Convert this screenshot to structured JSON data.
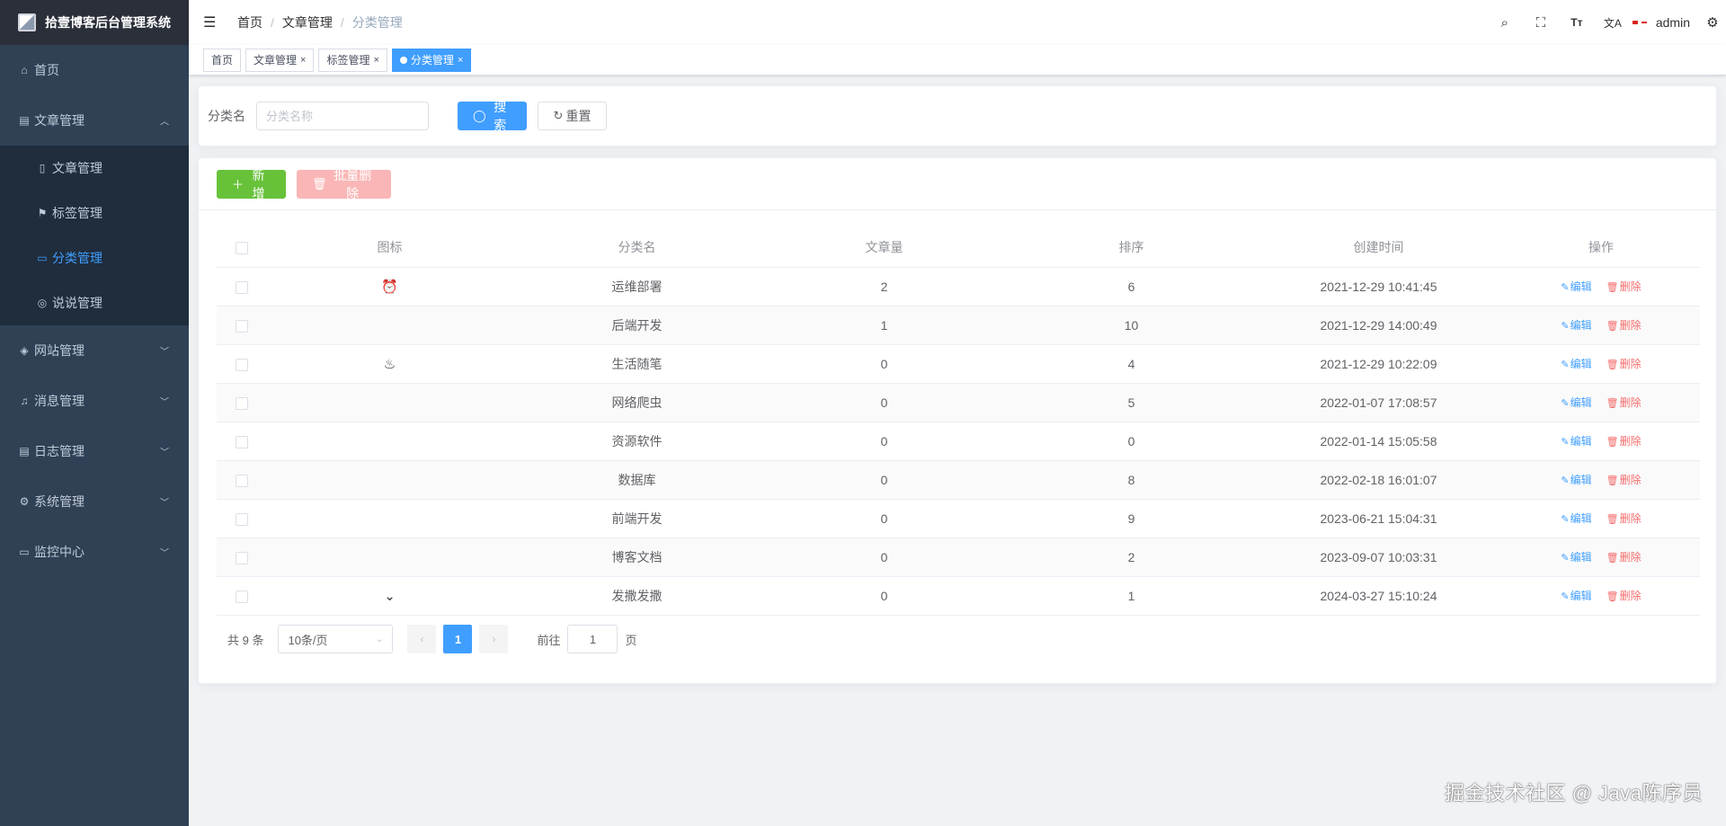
{
  "app": {
    "title": "拾壹博客后台管理系统"
  },
  "sidebar": {
    "items": [
      {
        "label": "首页",
        "icon": "home-icon",
        "glyph": "⌂"
      },
      {
        "label": "文章管理",
        "icon": "document-icon",
        "glyph": "▤",
        "expanded": true,
        "children": [
          {
            "label": "文章管理",
            "icon": "file-icon",
            "glyph": "▯"
          },
          {
            "label": "标签管理",
            "icon": "bookmark-icon",
            "glyph": "⚑"
          },
          {
            "label": "分类管理",
            "icon": "folder-icon",
            "glyph": "▭",
            "active": true
          },
          {
            "label": "说说管理",
            "icon": "bicycle-icon",
            "glyph": "◎"
          }
        ]
      },
      {
        "label": "网站管理",
        "icon": "site-icon",
        "glyph": "◈"
      },
      {
        "label": "消息管理",
        "icon": "bell-icon",
        "glyph": "♫"
      },
      {
        "label": "日志管理",
        "icon": "log-icon",
        "glyph": "▤"
      },
      {
        "label": "系统管理",
        "icon": "gear-icon",
        "glyph": "⚙"
      },
      {
        "label": "监控中心",
        "icon": "monitor-icon",
        "glyph": "▭"
      }
    ]
  },
  "navbar": {
    "breadcrumb": [
      "首页",
      "文章管理",
      "分类管理"
    ],
    "username": "admin"
  },
  "tags": [
    {
      "label": "首页",
      "closable": false,
      "active": false
    },
    {
      "label": "文章管理",
      "closable": true,
      "active": false
    },
    {
      "label": "标签管理",
      "closable": true,
      "active": false
    },
    {
      "label": "分类管理",
      "closable": true,
      "active": true
    }
  ],
  "search": {
    "label": "分类名",
    "placeholder": "分类名称",
    "search_label": "搜索",
    "reset_label": "重置"
  },
  "toolbar": {
    "add_label": "新增",
    "batch_delete_label": "批量删除"
  },
  "table": {
    "columns": [
      "图标",
      "分类名",
      "文章量",
      "排序",
      "创建时间",
      "操作"
    ],
    "edit_label": "编辑",
    "delete_label": "删除",
    "rows": [
      {
        "icon": "alarm-clock-icon",
        "glyph": "⏰",
        "name": "运维部署",
        "count": "2",
        "sort": "6",
        "created": "2021-12-29 10:41:45"
      },
      {
        "icon": "",
        "glyph": "",
        "name": "后端开发",
        "count": "1",
        "sort": "10",
        "created": "2021-12-29 14:00:49"
      },
      {
        "icon": "bowl-icon",
        "glyph": "♨",
        "name": "生活随笔",
        "count": "0",
        "sort": "4",
        "created": "2021-12-29 10:22:09"
      },
      {
        "icon": "",
        "glyph": "",
        "name": "网络爬虫",
        "count": "0",
        "sort": "5",
        "created": "2022-01-07 17:08:57"
      },
      {
        "icon": "",
        "glyph": "",
        "name": "资源软件",
        "count": "0",
        "sort": "0",
        "created": "2022-01-14 15:05:58"
      },
      {
        "icon": "",
        "glyph": "",
        "name": "数据库",
        "count": "0",
        "sort": "8",
        "created": "2022-02-18 16:01:07"
      },
      {
        "icon": "",
        "glyph": "",
        "name": "前端开发",
        "count": "0",
        "sort": "9",
        "created": "2023-06-21 15:04:31"
      },
      {
        "icon": "",
        "glyph": "",
        "name": "博客文档",
        "count": "0",
        "sort": "2",
        "created": "2023-09-07 10:03:31"
      },
      {
        "icon": "chevron-down-icon",
        "glyph": "⌄",
        "name": "发撒发撒",
        "count": "0",
        "sort": "1",
        "created": "2024-03-27 15:10:24"
      }
    ]
  },
  "pagination": {
    "total_text": "共 9 条",
    "page_size_text": "10条/页",
    "current_page": "1",
    "goto_label": "前往",
    "goto_value": "1",
    "page_suffix": "页"
  },
  "watermark": "掘金技术社区 @ Java陈序员",
  "colors": {
    "sidebar_bg": "#304156",
    "primary": "#409eff",
    "success": "#67c23a",
    "danger": "#f56c6c"
  }
}
